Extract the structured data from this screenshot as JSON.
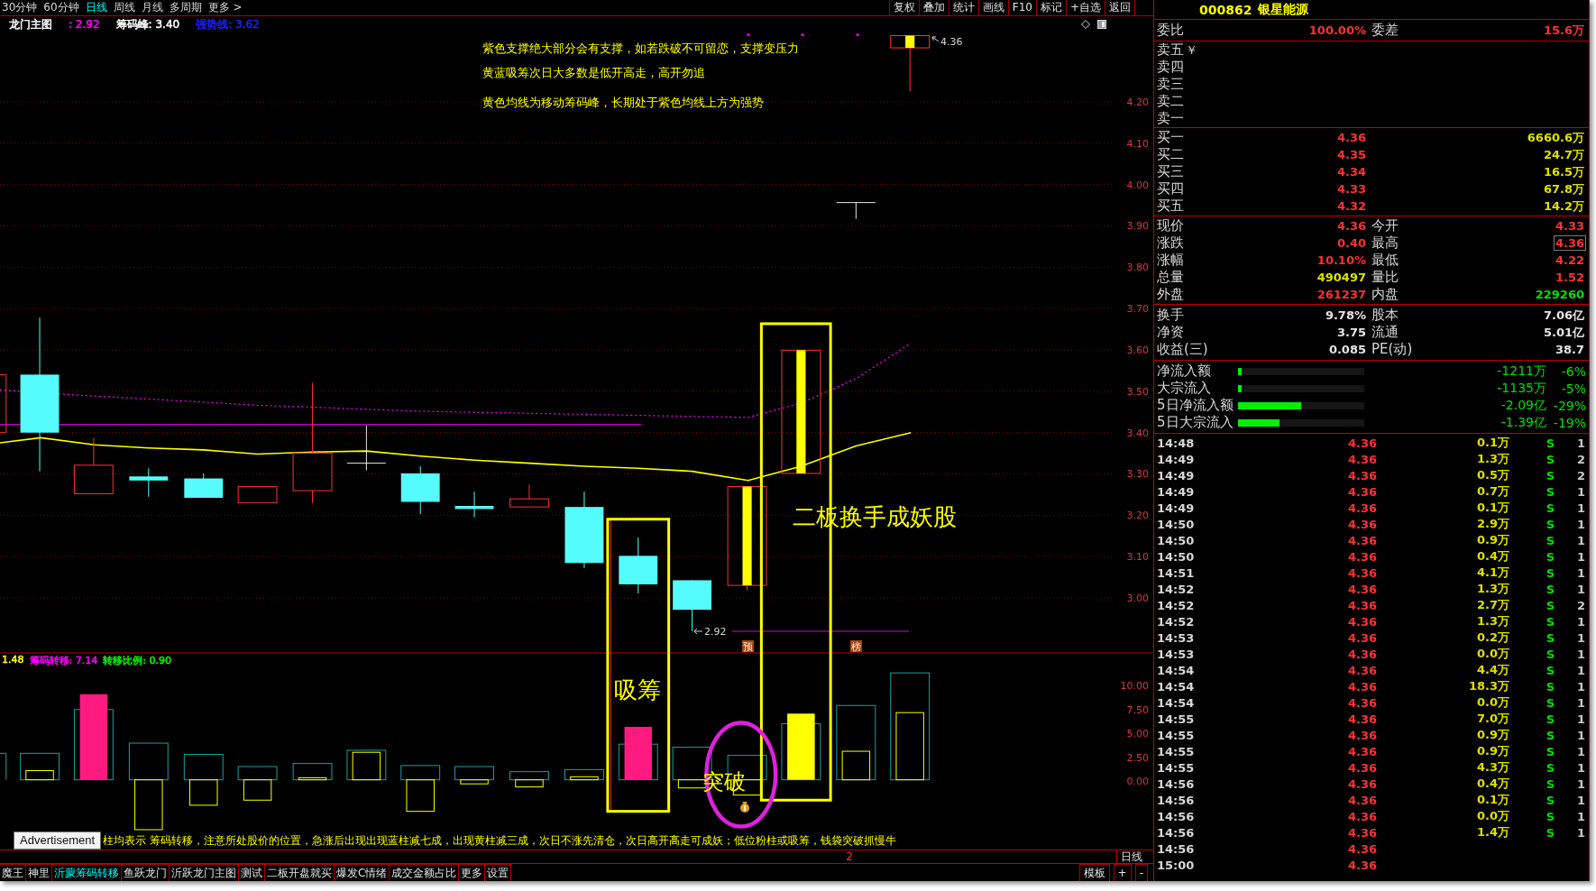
{
  "top_bar": {
    "period_tabs": [
      {
        "label": "30分钟",
        "selected": false
      },
      {
        "label": "60分钟",
        "selected": false
      },
      {
        "label": "日线",
        "selected": true
      },
      {
        "label": "周线",
        "selected": false
      },
      {
        "label": "月线",
        "selected": false
      },
      {
        "label": "多周期",
        "selected": false
      },
      {
        "label": "更多 >",
        "selected": false
      }
    ],
    "tool_buttons": [
      "复权",
      "叠加",
      "统计",
      "画线",
      "F10",
      "标记",
      "+自选",
      "返回"
    ]
  },
  "legend": [
    {
      "text": "龙门主图",
      "color": "#ffffff"
    },
    {
      "text": ": 2.92",
      "color": "#ff00ff"
    },
    {
      "text": "筹码峰: 3.40",
      "color": "#ffffff"
    },
    {
      "text": "强势线: 3.62",
      "color": "#2020ff"
    }
  ],
  "main_chart": {
    "notes": [
      "紫色支撑绝大部分会有支撑，如若跌破不可留恋，支撑变压力",
      "黄蓝吸筹次日大多数是低开高走，高开勿追",
      "黄色均线为移动筹码峰，长期处于紫色均线上方为强势"
    ],
    "price_labels": [
      "4.20",
      "4.10",
      "4.00",
      "3.90",
      "3.80",
      "3.70",
      "3.60",
      "3.50",
      "3.40",
      "3.30",
      "3.20",
      "3.10",
      "3.00"
    ],
    "high_label": "4.36",
    "low_label": "2.92",
    "badges": [
      "预",
      "榜"
    ],
    "callouts": [
      {
        "kind": "accumulate",
        "text": "吸筹"
      },
      {
        "kind": "breakout",
        "text": "突破"
      },
      {
        "kind": "headline",
        "text": "二板换手成妖股"
      }
    ]
  },
  "indicator": {
    "legend": [
      {
        "text": "1.48",
        "color": "#ffff00"
      },
      {
        "text": "筹码转移: 7.14",
        "color": "#ff00ff"
      },
      {
        "text": "转移比例: 0.90",
        "color": "#00ff00"
      }
    ],
    "axis_labels": [
      "10.00",
      "7.50",
      "5.00",
      "2.50",
      "0.00"
    ]
  },
  "advertisement": "Advertisement",
  "note": "柱均表示 筹码转移，注意所处股价的位置，急涨后出现出现蓝柱减七成，出现黄柱减三成，次日不涨先清仓，次日高开高走可成妖；低位粉柱或吸筹，钱袋突破抓慢牛",
  "status": {
    "page": "2",
    "period": "日线"
  },
  "bottom_tabs": [
    {
      "label": "魔王",
      "selected": false
    },
    {
      "label": "神里",
      "selected": false
    },
    {
      "label": "沂蒙筹码转移",
      "selected": true
    },
    {
      "label": "鱼跃龙门",
      "selected": false
    },
    {
      "label": "沂跃龙门主图",
      "selected": false
    },
    {
      "label": "测试",
      "selected": false
    },
    {
      "label": "二板开盘就买",
      "selected": false
    },
    {
      "label": "爆发C情绪",
      "selected": false
    },
    {
      "label": "成交金额占比",
      "selected": false
    },
    {
      "label": "更多",
      "selected": false
    },
    {
      "label": "设置",
      "selected": false
    }
  ],
  "bottom_buttons": [
    "模板",
    "+",
    "-"
  ],
  "quote_panel": {
    "stock": {
      "code": "000862",
      "name": "银星能源"
    },
    "order_ratio": [
      {
        "label": "委比",
        "value": "100.00%",
        "color": "#ff3232"
      },
      {
        "label": "委差",
        "value": "15.6万",
        "color": "#ff3232"
      }
    ],
    "asks": [
      {
        "label": "卖五",
        "symbol": "￥"
      },
      {
        "label": "卖四"
      },
      {
        "label": "卖三"
      },
      {
        "label": "卖二"
      },
      {
        "label": "卖一"
      }
    ],
    "bids": [
      {
        "label": "买一",
        "price": "4.36",
        "volume": "6660.6万"
      },
      {
        "label": "买二",
        "price": "4.35",
        "volume": "24.7万"
      },
      {
        "label": "买三",
        "price": "4.34",
        "volume": "16.5万"
      },
      {
        "label": "买四",
        "price": "4.33",
        "volume": "67.8万"
      },
      {
        "label": "买五",
        "price": "4.32",
        "volume": "14.2万"
      }
    ],
    "quote": [
      {
        "label": "现价",
        "value": "4.36",
        "color": "#ff3232",
        "highlighted": false
      },
      {
        "label": "今开",
        "value": "4.33",
        "color": "#ff3232",
        "highlighted": false
      },
      {
        "label": "涨跌",
        "value": "0.40",
        "color": "#ff3232",
        "highlighted": false
      },
      {
        "label": "最高",
        "value": "4.36",
        "color": "#ff3232",
        "highlighted": true
      },
      {
        "label": "涨幅",
        "value": "10.10%",
        "color": "#ff3232",
        "highlighted": false
      },
      {
        "label": "最低",
        "value": "4.22",
        "color": "#ff3232",
        "highlighted": false
      },
      {
        "label": "总量",
        "value": "490497",
        "color": "#e0e000",
        "highlighted": false
      },
      {
        "label": "量比",
        "value": "1.52",
        "color": "#ff3232",
        "highlighted": false
      },
      {
        "label": "外盘",
        "value": "261237",
        "color": "#ff3232",
        "highlighted": false
      },
      {
        "label": "内盘",
        "value": "229260",
        "color": "#00e000",
        "highlighted": false
      }
    ],
    "fundamentals": [
      {
        "label": "换手",
        "value": "9.78%"
      },
      {
        "label": "股本",
        "value": "7.06亿"
      },
      {
        "label": "净资",
        "value": "3.75"
      },
      {
        "label": "流通",
        "value": "5.01亿"
      },
      {
        "label": "收益(三)",
        "value": "0.085"
      },
      {
        "label": "PE(动)",
        "value": "38.7"
      }
    ],
    "fund_flow": [
      {
        "label": "净流入额",
        "level": 0.03,
        "amount": "-1211万",
        "percent": "-6%"
      },
      {
        "label": "大宗流入",
        "level": 0.03,
        "amount": "-1135万",
        "percent": "-5%"
      },
      {
        "label": "5日净流入额",
        "level": 0.5,
        "amount": "-2.09亿",
        "percent": "-29%"
      },
      {
        "label": "5日大宗流入",
        "level": 0.33,
        "amount": "-1.39亿",
        "percent": "-19%"
      }
    ],
    "ticks": [
      {
        "time": "14:48",
        "price": "4.36",
        "volume": "0.1万",
        "side": "S",
        "count": "1"
      },
      {
        "time": "14:49",
        "price": "4.36",
        "volume": "1.3万",
        "side": "S",
        "count": "2"
      },
      {
        "time": "14:49",
        "price": "4.36",
        "volume": "0.5万",
        "side": "S",
        "count": "2"
      },
      {
        "time": "14:49",
        "price": "4.36",
        "volume": "0.7万",
        "side": "S",
        "count": "1"
      },
      {
        "time": "14:49",
        "price": "4.36",
        "volume": "0.1万",
        "side": "S",
        "count": "1"
      },
      {
        "time": "14:50",
        "price": "4.36",
        "volume": "2.9万",
        "side": "S",
        "count": "1"
      },
      {
        "time": "14:50",
        "price": "4.36",
        "volume": "0.9万",
        "side": "S",
        "count": "1"
      },
      {
        "time": "14:50",
        "price": "4.36",
        "volume": "0.4万",
        "side": "S",
        "count": "1"
      },
      {
        "time": "14:51",
        "price": "4.36",
        "volume": "4.1万",
        "side": "S",
        "count": "1"
      },
      {
        "time": "14:52",
        "price": "4.36",
        "volume": "1.3万",
        "side": "S",
        "count": "1"
      },
      {
        "time": "14:52",
        "price": "4.36",
        "volume": "2.7万",
        "side": "S",
        "count": "2"
      },
      {
        "time": "14:52",
        "price": "4.36",
        "volume": "1.3万",
        "side": "S",
        "count": "1"
      },
      {
        "time": "14:53",
        "price": "4.36",
        "volume": "0.2万",
        "side": "S",
        "count": "1"
      },
      {
        "time": "14:53",
        "price": "4.36",
        "volume": "0.0万",
        "side": "S",
        "count": "1"
      },
      {
        "time": "14:54",
        "price": "4.36",
        "volume": "4.4万",
        "side": "S",
        "count": "1"
      },
      {
        "time": "14:54",
        "price": "4.36",
        "volume": "18.3万",
        "side": "S",
        "count": "1"
      },
      {
        "time": "14:54",
        "price": "4.36",
        "volume": "0.0万",
        "side": "S",
        "count": "1"
      },
      {
        "time": "14:55",
        "price": "4.36",
        "volume": "7.0万",
        "side": "S",
        "count": "1"
      },
      {
        "time": "14:55",
        "price": "4.36",
        "volume": "0.9万",
        "side": "S",
        "count": "1"
      },
      {
        "time": "14:55",
        "price": "4.36",
        "volume": "0.9万",
        "side": "S",
        "count": "1"
      },
      {
        "time": "14:55",
        "price": "4.36",
        "volume": "4.3万",
        "side": "S",
        "count": "1"
      },
      {
        "time": "14:56",
        "price": "4.36",
        "volume": "0.4万",
        "side": "S",
        "count": "1"
      },
      {
        "time": "14:56",
        "price": "4.36",
        "volume": "0.1万",
        "side": "S",
        "count": "1"
      },
      {
        "time": "14:56",
        "price": "4.36",
        "volume": "0.0万",
        "side": "S",
        "count": "1"
      },
      {
        "time": "14:56",
        "price": "4.36",
        "volume": "1.4万",
        "side": "S",
        "count": "1"
      },
      {
        "time": "14:56",
        "price": "4.36"
      },
      {
        "time": "15:00",
        "price": "4.36"
      }
    ]
  }
}
